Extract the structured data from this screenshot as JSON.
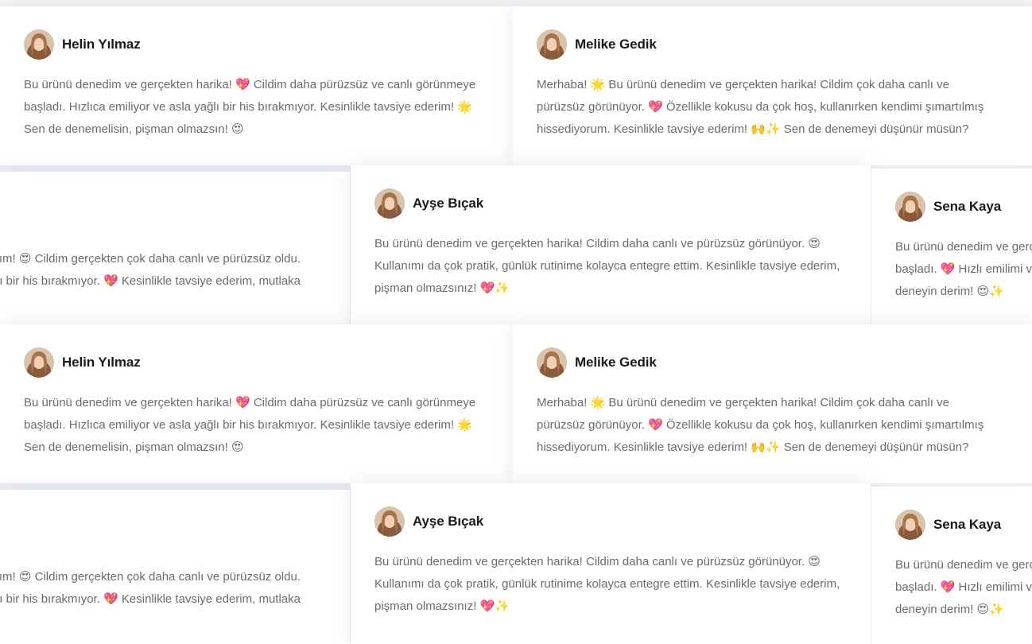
{
  "testimonials": {
    "helin": {
      "name": "Helin Yılmaz",
      "text": "Bu ürünü denedim ve gerçekten harika! 💖 Cildim daha pürüzsüz ve canlı görünmeye başladı. Hızlıca emiliyor ve asla yağlı bir his bırakmıyor. Kesinlikle tavsiye ederim! 🌟 Sen de denemelisin, pişman olmazsın! 😍"
    },
    "melike": {
      "name": "Melike Gedik",
      "text": "Merhaba! 🌟 Bu ürünü denedim ve gerçekten harika! Cildim çok daha canlı ve pürüzsüz görünüyor. 💖 Özellikle kokusu da çok hoş, kullanırken kendimi şımartılmış hissediyorum. Kesinlikle tavsiye ederim! 🙌✨ Sen de denemeyi düşünür müsün?"
    },
    "ayse": {
      "name": "Ayşe Bıçak",
      "text": "Bu ürünü denedim ve gerçekten harika! Cildim daha canlı ve pürüzsüz görünüyor. 😍 Kullanımı da çok pratik, günlük rutinime kolayca entegre ettim. Kesinlikle tavsiye ederim, pişman olmazsınız! 💖✨"
    },
    "sena": {
      "name": "Sena Kaya",
      "line1": "Bu ürünü denedim ve gerç",
      "line2": "başladı. 💖 Hızlı emilimi ve",
      "line3": "deneyin derim! 😍✨"
    },
    "partial": {
      "line1": "ayıldım! 😍 Cildim gerçekten çok daha canlı ve pürüzsüz oldu.",
      "line2": "ağlı bir his bırakmıyor. 💖 Kesinlikle tavsiye ederim, mutlaka"
    }
  }
}
